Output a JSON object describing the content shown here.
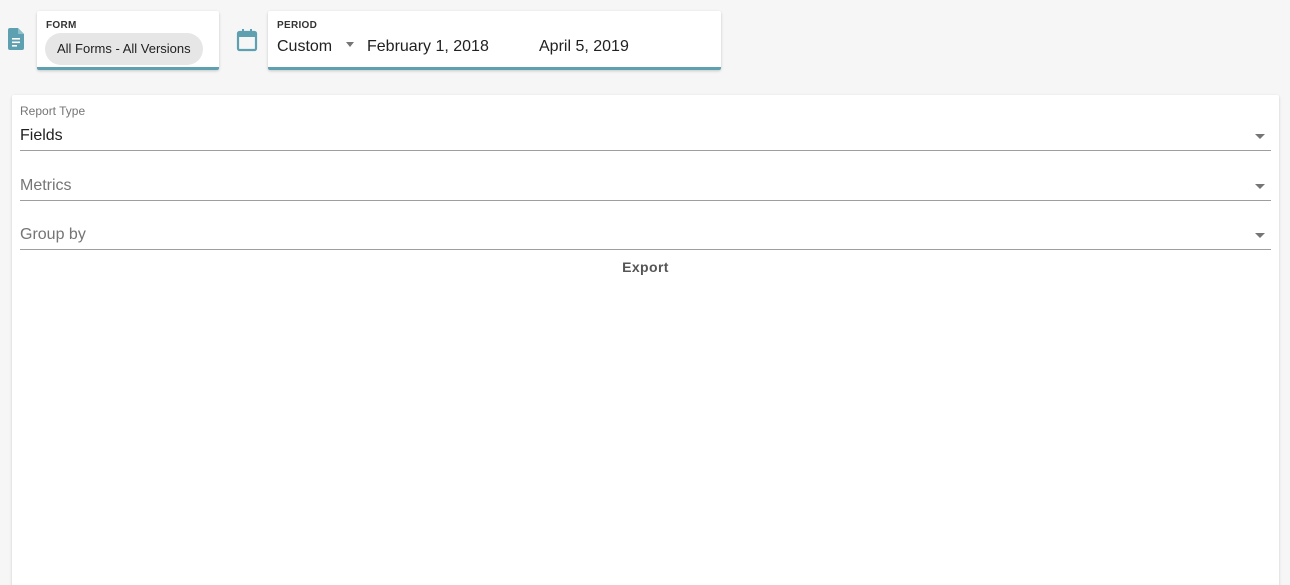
{
  "filter_bar": {
    "form": {
      "icon": "document-icon",
      "label": "FORM",
      "value": "All Forms - All Versions"
    },
    "period": {
      "icon": "calendar-icon",
      "label": "PERIOD",
      "selected": "Custom",
      "start_date": "February 1, 2018",
      "end_date": "April 5, 2019"
    },
    "accent_color": "#5e9fb0"
  },
  "report": {
    "report_type": {
      "label": "Report Type",
      "value": "Fields"
    },
    "metrics": {
      "placeholder": "Metrics"
    },
    "group_by": {
      "placeholder": "Group by"
    },
    "export_label": "Export"
  }
}
